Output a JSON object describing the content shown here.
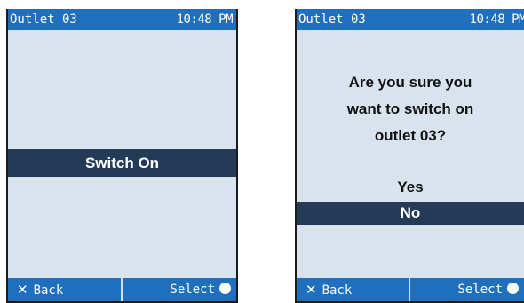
{
  "screens": [
    {
      "statusbar": {
        "title": "Outlet 03",
        "time": "10:48 PM"
      },
      "menu": {
        "selected_item": "Switch On"
      },
      "softkeys": {
        "left_label": "Back",
        "right_label": "Select"
      }
    },
    {
      "statusbar": {
        "title": "Outlet 03",
        "time": "10:48 PM"
      },
      "dialog": {
        "prompt_line_1": "Are you sure you",
        "prompt_line_2": "want to switch on",
        "prompt_line_3": "outlet 03?",
        "option_yes": "Yes",
        "option_no": "No",
        "selected_option": "No"
      },
      "softkeys": {
        "left_label": "Back",
        "right_label": "Select"
      }
    }
  ],
  "icons": {
    "back": "x-icon",
    "select": "filled-circle-icon"
  },
  "colors": {
    "statusbar_bg": "#1f6fbd",
    "screen_bg": "#d8e3ee",
    "selection_bg": "#243b57",
    "softkey_text": "#ffffff"
  }
}
